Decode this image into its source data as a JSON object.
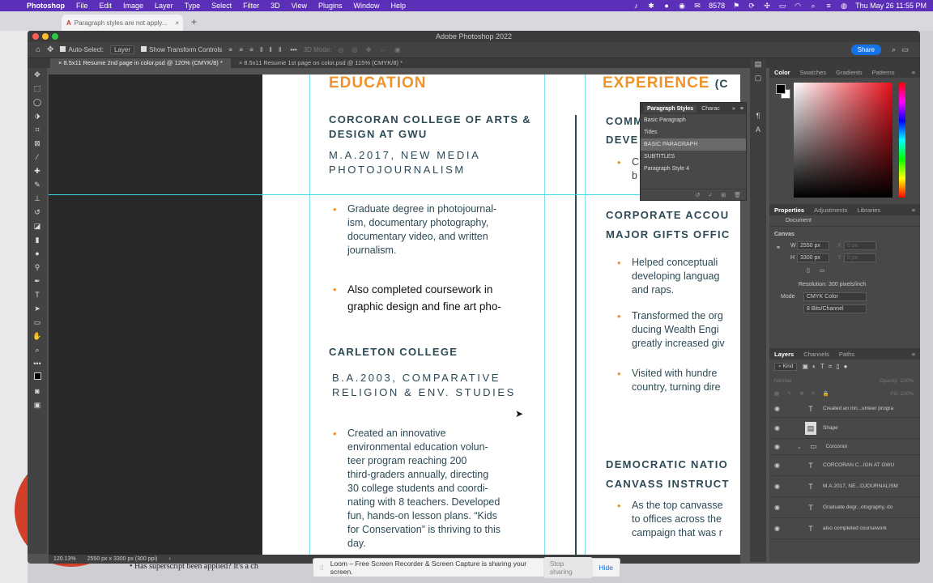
{
  "menubar": {
    "app": "Photoshop",
    "items": [
      "File",
      "Edit",
      "Image",
      "Layer",
      "Type",
      "Select",
      "Filter",
      "3D",
      "View",
      "Plugins",
      "Window",
      "Help"
    ],
    "battery": "8578",
    "clock": "Thu May 26  11:55 PM"
  },
  "browser": {
    "tab_title": "Paragraph styles are not apply...",
    "doc_snippet": "Has superscript been applied? It's a ch"
  },
  "ps": {
    "window_title": "Adobe Photoshop 2022",
    "options": {
      "auto_select": "Auto-Select:",
      "layer_select": "Layer",
      "show_transform": "Show Transform Controls",
      "mode_3d": "3D Mode:",
      "share": "Share"
    },
    "doc_tabs": [
      "8.5x11 Resume 2nd page in color.psd @ 120% (CMYK/8) *",
      "8.5x11 Resume 1st page on color.psd @ 115% (CMYK/8) *"
    ],
    "status": {
      "zoom": "120.13%",
      "size": "2550 px x 3300 px (300 ppi)"
    }
  },
  "resume": {
    "education": "EDUCATION",
    "experience": "EXPERIENCE",
    "experience_suffix": "(C",
    "school1": [
      "CORCORAN COLLEGE OF ARTS &",
      "DESIGN AT GWU"
    ],
    "degree1": [
      "M.A.2017, NEW MEDIA",
      "PHOTOJOURNALISM"
    ],
    "bullet1": [
      "Graduate degree in photojournal-",
      "ism, documentary photography,",
      "documentary video, and written",
      "journalism."
    ],
    "bullet2": [
      "Also completed coursework in",
      "graphic design and fine art pho-"
    ],
    "school2": "CARLETON COLLEGE",
    "degree2": [
      "B.A.2003, COMPARATIVE",
      "RELIGION & ENV. STUDIES"
    ],
    "bullet3": [
      "Created an innovative",
      "environmental education volun-",
      "teer program reaching 200",
      "third-graders annually, directing",
      "30 college students and coordi-",
      "nating with 8 teachers. Developed",
      "fun, hands-on lesson plans. “Kids",
      "for Conservation” is thriving to this",
      "day."
    ],
    "exp1": [
      "COMM",
      "DEVE"
    ],
    "exp1_bullet": [
      "C",
      "b"
    ],
    "exp2": [
      "CORPORATE ACCOU",
      "MAJOR GIFTS OFFIC"
    ],
    "exp2_b1": [
      "Helped conceptuali",
      "developing languag",
      "and raps."
    ],
    "exp2_b2": [
      "Transformed the org",
      "ducing Wealth Engi",
      "greatly increased giv"
    ],
    "exp2_b3": [
      "Visited with hundre",
      "country, turning dire"
    ],
    "exp3": [
      "DEMOCRATIC NATIO",
      "CANVASS INSTRUCT"
    ],
    "exp3_b1": [
      "As the top canvasse",
      "to offices across the",
      "campaign that was r"
    ]
  },
  "paragraph_styles": {
    "tabs": [
      "Paragraph Styles",
      "Charac"
    ],
    "items": [
      "Basic Paragraph",
      "Titles",
      "BASIC PARAGRAPH",
      "SUBTITLES",
      "Paragraph Style 4"
    ],
    "selected": "BASIC PARAGRAPH"
  },
  "color_panel": {
    "tabs": [
      "Color",
      "Swatches",
      "Gradients",
      "Patterns"
    ],
    "fg": "#000000",
    "bg": "#ffffff"
  },
  "properties": {
    "tabs": [
      "Properties",
      "Adjustments",
      "Libraries"
    ],
    "type": "Document",
    "section": "Canvas",
    "w_label": "W",
    "w": "2550 px",
    "h_label": "H",
    "h": "3300 px",
    "x_label": "X",
    "x_val": "0 px",
    "y_label": "Y",
    "y_val": "0 px",
    "resolution": "Resolution: 300 pixels/inch",
    "mode_label": "Mode",
    "mode": "CMYK Color",
    "bits": "8 Bits/Channel"
  },
  "layers": {
    "tabs": [
      "Layers",
      "Channels",
      "Paths"
    ],
    "filter": "Kind",
    "blend": "Normal",
    "opacity": "Opacity: 100%",
    "fill": "Fill: 100%",
    "rows": [
      {
        "name": "Created an inn...unteer progra",
        "kind": "T"
      },
      {
        "name": "Shape",
        "kind": "shape"
      },
      {
        "name": "Corcoran",
        "kind": "folder"
      },
      {
        "name": "CORCORAN C...IGN AT GWU",
        "kind": "T"
      },
      {
        "name": "M.A.2017, NE...OJOURNALISM",
        "kind": "T"
      },
      {
        "name": "Graduate degr...otography, do",
        "kind": "T"
      },
      {
        "name": "also completed coursework",
        "kind": "T"
      }
    ]
  },
  "loom": {
    "message": "Loom – Free Screen Recorder & Screen Capture is sharing your screen.",
    "stop": "Stop sharing",
    "hide": "Hide"
  },
  "colors": {
    "accent_orange": "#f0932b",
    "navy": "#2c4a56",
    "guide": "#3ddbe3",
    "share_blue": "#1473e6",
    "menubar": "#5b2fb8"
  }
}
